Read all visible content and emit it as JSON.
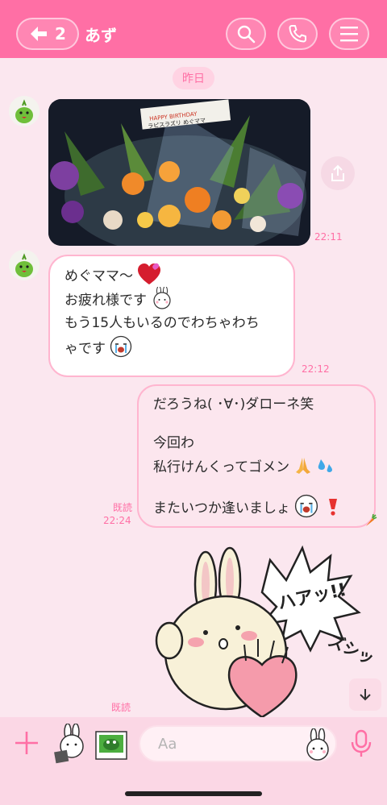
{
  "header": {
    "back_count": "2",
    "title": "あず",
    "accent_color": "#ff6fa5",
    "icons": [
      "back-arrow-icon",
      "search-icon",
      "phone-icon",
      "menu-icon"
    ]
  },
  "date_label": "昨日",
  "messages": [
    {
      "type": "photo",
      "direction": "incoming",
      "time": "22:11",
      "photo_caption_lines": [
        "HAPPY BIRTHDAY",
        "ラピスラズリ めぐママ"
      ]
    },
    {
      "type": "text",
      "direction": "incoming",
      "time": "22:12",
      "lines": [
        "めぐママ〜",
        "お疲れ様です",
        "もう15人もいるのでわちゃわち",
        "ゃです"
      ]
    },
    {
      "type": "text",
      "direction": "outgoing",
      "read_label": "既読",
      "time": "22:24",
      "lines": [
        "だろうね( ･∀･)ダローネ笑",
        "",
        "今回わ",
        "私行けんくってゴメン",
        "",
        "またいつか逢いましょ"
      ]
    },
    {
      "type": "sticker",
      "direction": "outgoing",
      "read_label": "既読",
      "sticker_text": [
        "ハアッ!!",
        "ズシッ"
      ]
    }
  ],
  "footer": {
    "input_placeholder": "Aa",
    "icons": [
      "plus-icon",
      "sticker-icon",
      "photo-icon",
      "emoji-icon",
      "mic-icon"
    ]
  }
}
